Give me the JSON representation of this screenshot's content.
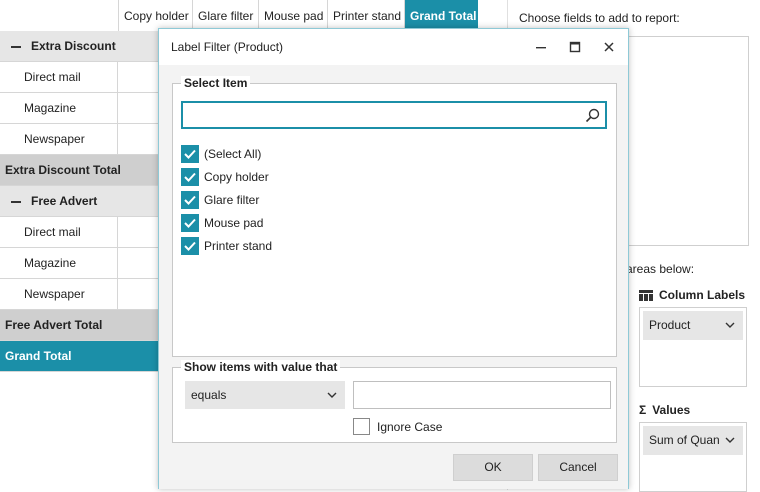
{
  "pivot": {
    "column_headers": [
      "Copy holder",
      "Glare filter",
      "Mouse pad",
      "Printer stand",
      "Grand Total"
    ],
    "rows": [
      {
        "type": "group",
        "label": "Extra Discount"
      },
      {
        "type": "item",
        "label": "Direct mail"
      },
      {
        "type": "item",
        "label": "Magazine"
      },
      {
        "type": "item",
        "label": "Newspaper"
      },
      {
        "type": "total",
        "label": "Extra Discount Total"
      },
      {
        "type": "group",
        "label": "Free Advert"
      },
      {
        "type": "item",
        "label": "Direct mail"
      },
      {
        "type": "item",
        "label": "Magazine"
      },
      {
        "type": "item",
        "label": "Newspaper"
      },
      {
        "type": "total",
        "label": "Free Advert Total"
      },
      {
        "type": "grand",
        "label": "Grand Total"
      }
    ]
  },
  "field_list": {
    "title": "Choose fields to add to report:",
    "areas_hint": "areas below:",
    "column_labels": {
      "title": "Column Labels",
      "chip": "Product"
    },
    "values": {
      "title": "Values",
      "chip": "Sum of Quan"
    }
  },
  "dialog": {
    "title": "Label Filter (Product)",
    "select_item": {
      "legend": "Select Item",
      "search_value": "",
      "items": [
        {
          "label": "(Select All)",
          "checked": true
        },
        {
          "label": "Copy holder",
          "checked": true
        },
        {
          "label": "Glare filter",
          "checked": true
        },
        {
          "label": "Mouse pad",
          "checked": true
        },
        {
          "label": "Printer stand",
          "checked": true
        }
      ]
    },
    "condition": {
      "legend": "Show items with value that",
      "operator": "equals",
      "value": "",
      "ignore_case_label": "Ignore Case",
      "ignore_case": false
    },
    "ok_label": "OK",
    "cancel_label": "Cancel"
  },
  "colors": {
    "accent": "#1b8fa8",
    "subtotal_bg": "#cfcfcf",
    "group_bg": "#e6e6e6"
  }
}
